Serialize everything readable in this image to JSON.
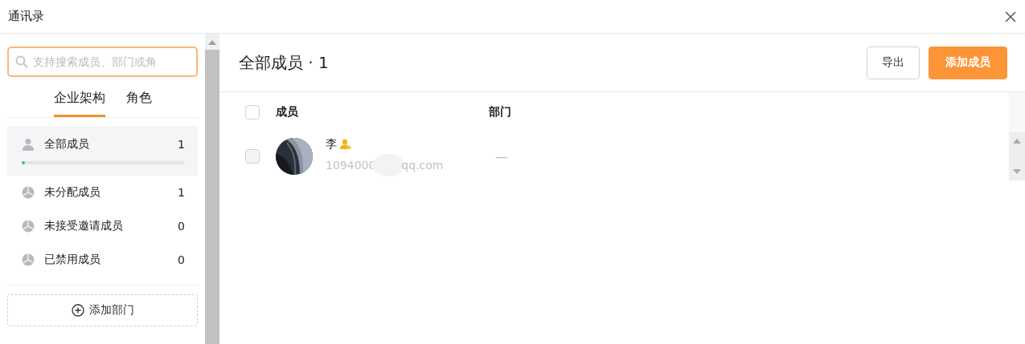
{
  "window": {
    "title": "通讯录"
  },
  "search": {
    "placeholder": "支持搜索成员、部门或角"
  },
  "tabs": [
    {
      "label": "企业架构",
      "selected": true
    },
    {
      "label": "角色",
      "selected": false
    }
  ],
  "groups": [
    {
      "kind": "all",
      "label": "全部成员",
      "count": "1",
      "selected": true,
      "level": 0.01
    },
    {
      "kind": "group",
      "label": "未分配成员",
      "count": "1",
      "selected": false
    },
    {
      "kind": "group",
      "label": "未接受邀请成员",
      "count": "0",
      "selected": false
    },
    {
      "kind": "group",
      "label": "已禁用成员",
      "count": "0",
      "selected": false
    }
  ],
  "add_department": "添加部门",
  "header": {
    "title": "全部成员 · 1",
    "buttons": [
      {
        "label": "导出",
        "kind": "secondary"
      },
      {
        "label": "添加成员",
        "kind": "primary"
      }
    ]
  },
  "table": {
    "select_all_checked": false,
    "columns": [
      "成员",
      "部门"
    ],
    "rows": [
      {
        "checked": false,
        "name": "李",
        "admin": true,
        "email_start": "1094000",
        "email_end": "qq.com",
        "department": "—"
      }
    ]
  }
}
